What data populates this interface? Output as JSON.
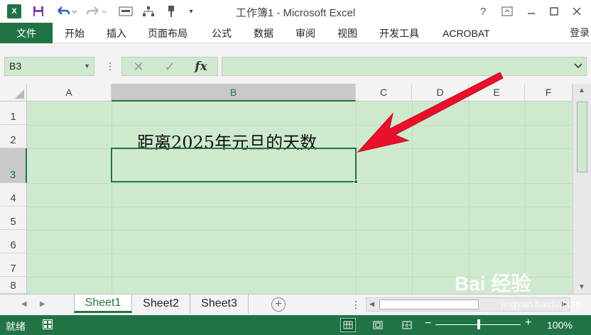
{
  "window": {
    "title": "工作簿1 - Microsoft Excel",
    "help": "?",
    "controls": [
      "ribbon-display",
      "minimize",
      "maximize",
      "close"
    ]
  },
  "qat": {
    "logo": "X",
    "icons": [
      "save-icon",
      "undo-icon",
      "redo-icon",
      "form-icon",
      "org-chart-icon",
      "pin-icon",
      "customize-icon"
    ]
  },
  "ribbon": {
    "file_tab": "文件",
    "tabs": [
      "开始",
      "插入",
      "页面布局",
      "公式",
      "数据",
      "审阅",
      "视图",
      "开发工具",
      "ACROBAT"
    ],
    "login": "登录"
  },
  "formula_bar": {
    "name_box": "B3",
    "fx": "fx",
    "formula_value": ""
  },
  "grid": {
    "columns": [
      "A",
      "B",
      "C",
      "D",
      "E",
      "F"
    ],
    "rows": [
      "1",
      "2",
      "3",
      "4",
      "5",
      "6",
      "7",
      "8"
    ],
    "selected_column": "B",
    "selected_row": "3",
    "cells": {
      "B2": "距离2025年元旦的天数",
      "B3": ""
    }
  },
  "sheets": {
    "tabs": [
      "Sheet1",
      "Sheet2",
      "Sheet3"
    ],
    "active": "Sheet1"
  },
  "status": {
    "ready": "就绪",
    "zoom": "100%"
  },
  "watermark": {
    "main": "Bai 经验",
    "sub": "jingyan.baidu.com"
  },
  "colors": {
    "accent": "#217346",
    "cell_background": "#cfe9cf",
    "annotation_arrow": "#e8102a"
  }
}
